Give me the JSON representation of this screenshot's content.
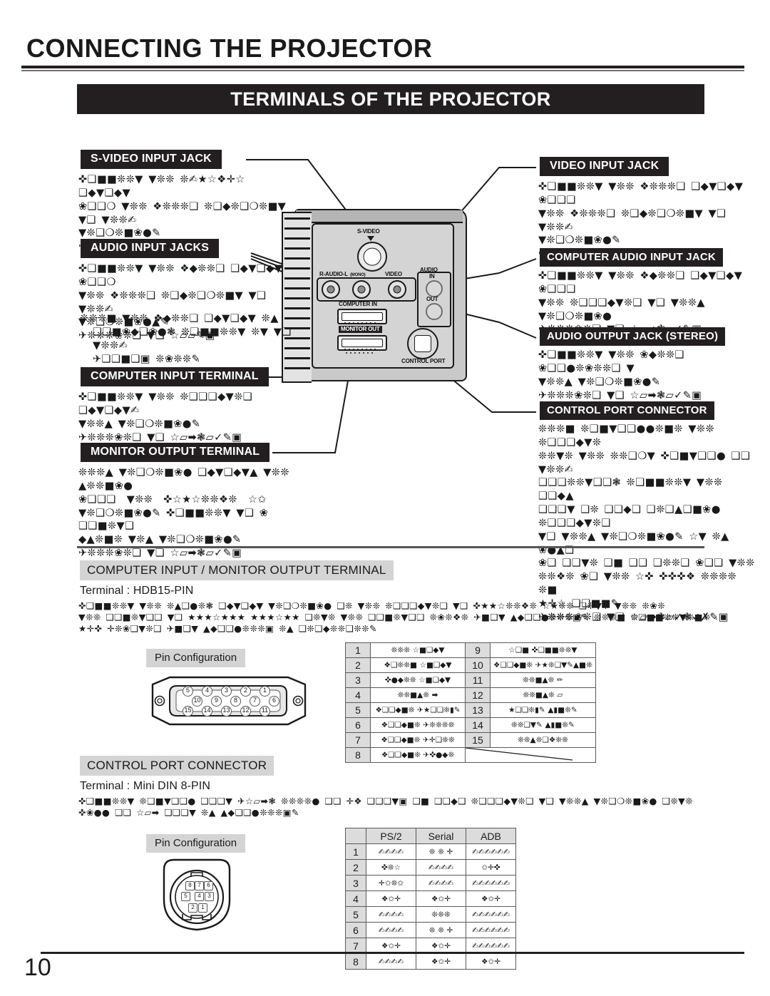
{
  "page": {
    "chapter_title": "CONNECTING THE PROJECTOR",
    "section_banner": "TERMINALS OF THE PROJECTOR",
    "page_number": "10"
  },
  "callouts": {
    "s_video_input_jack": {
      "label": "S-VIDEO INPUT JACK",
      "body": "✜❑■■❊❊▼ ▼❊❊ ❊✍★☆❖✛☆ ❑◆▼❑◆▼\n❀❑❑❍ ▼❊❊ ❖❊❊❊❑ ❊❑◆❊❑❍❊■▼ ▼❑ ▼❊❊✍\n▼❊❑❍❊■❀●✎\n✈❊❊❊❀❊❑ ▼❑ ☆▱▱✎▣"
    },
    "audio_input_jacks": {
      "label": "AUDIO INPUT JACKS",
      "body": "✜❑■■❊❊▼ ▼❊❊ ❖◆❊❊❑ ❑◆▼❑◆▼ ❀❑❑❍\n▼❊❊ ❖❊❊❊❑ ❊❑◆❊❑❍❊■▼ ▼❑ ▼❊❊✍\n▼❊❑❍❊■❀●▲✎\n✈❊❊❊❀❊❑ ▼❑ ☆▱▱✎▣",
      "note": "❊❊❊■ ▼❊❊ ❖◆❊❊❑ ❑◆▼❑◆▼ ❊▲\n❑❑■❀◆❑❀●❃ ❊❑■■❊❊▼ ❊▼ ▼❑ ▼❊❊✍\n✈❑❑■❑▣ ❊❀❊❊✎"
    },
    "computer_input_terminal": {
      "label": "COMPUTER INPUT TERMINAL",
      "body": "✜❑■■❊❊▼ ▼❊❊ ❊❑❑❑◆▼❊❑ ❑◆▼❑◆▼✍\n▼❊❊▲ ▼❊❑❍❊■❀●✎\n✈❊❊❊❀❊❑ ▼❑ ☆▱➡❃▱✓✎▣"
    },
    "monitor_output_terminal": {
      "label": "MONITOR OUTPUT TERMINAL",
      "body": "❊❊❊▲ ▼❊❑❍❊■❀● ❑◆▼❑◆▼▲ ▼❊❊ ▲❊❊■❀●\n❀❑❑❑  ▼❊❊  ✜☆★☆❊❊❖❊  ☆✩\n▼❊❑❍❊■❀●✎ ✜❑■■❊❊▼ ▼❑ ❀ ❑❑■❊▼❑\n◆▲❊■❊ ▼❊▲ ▼❊❑❍❊■❀●✎\n✈❊❊❊❀❊❑ ▼❑ ☆▱➡❃▱✓✎▣"
    },
    "video_input_jack": {
      "label": "VIDEO INPUT JACK",
      "body": "✜❑■■❊❊▼ ▼❊❊ ❖❊❊❊❑ ❑◆▼❑◆▼ ❀❑❑❑\n▼❊❊ ❖❊❊❊❑ ❊❑◆❊❑❍❊■▼ ▼❑ ▼❊❊✍\n▼❊❑❍❊■❀●✎\n✈❊❊❊❀❊❑ ▼❑ ☆▱▱✎▣"
    },
    "computer_audio_input_jack": {
      "label": "COMPUTER AUDIO INPUT JACK",
      "body": "✜❑■■❊❊▼ ▼❊❊ ❖◆❊❊❑ ❑◆▼❑◆▼ ❀❑❑❑\n▼❊❊ ❊❑❑❑◆▼❊❑ ▼❑ ▼❊❊▲ ▼❊❑❍❊■❀●\n✈❊❊❊❀❊❑ ▼❑ ☆▱➡❃▱✓✎▣"
    },
    "audio_output_jack_stereo": {
      "label": "AUDIO OUTPUT JACK (STEREO)",
      "body": "✜❑■■❊❊▼ ▼❊❊ ❀◆❊❊❑ ❀❑❑●❊❀❊❊❑ ▼\n▼❊❊▲ ▼❊❑❍❊■❀●✎\n✈❊❊❊❀❊❑ ▼❑ ☆▱➡❃▱✓✎▣"
    },
    "control_port_connector": {
      "label": "CONTROL PORT CONNECTOR",
      "body": "❊❊❊■ ❊❑■▼❑❑●●❊■❊ ▼❊❊ ❊❑❑❑◆▼❊\n❊❊▼❊ ▼❊❊ ❊❊❑❍▼ ✜❑■▼❑❑● ❑❑ ▼❊❊✍\n❑❑❑❊❊▼❑❑❃ ❊❑■■❊❊▼ ▼❊❊ ❑❑◆▲\n❑❑❑▼ ❑❊ ❑❑◆❑ ❑❊❑▲❑■❀● ❊❑❑❑◆▼❊❑\n▼❑ ▼❊❊▲ ▼❊❑❍❊■❀●✎ ☆▼ ❊▲ ❀●▲❑\n❀❑ ❑❑▼❊ ❑■ ❑❑ ❑❊❊❑ ❀❑❑ ▼❊❊\n❊❊❖❊ ❀❑ ▼❊❊ ☆✜ ✜✜✜❖ ❊❊❊❊ ❊■\n★✛☆ ❑❑■■✎\n✈❊❊❊❀❊❑ ▼❑ ☆▱➡❃▱✓❃✓✗✎▣"
    }
  },
  "illustration": {
    "jack_labels": {
      "s_video": "S-VIDEO",
      "r_audio_l": "R-AUDIO-L",
      "mono": "(MONO)",
      "video": "VIDEO",
      "audio": "AUDIO",
      "in": "IN",
      "out": "OUT",
      "computer_in": "COMPUTER IN",
      "monitor_out": "MONITOR OUT",
      "control_port": "CONTROL PORT"
    }
  },
  "computer_section": {
    "heading": "COMPUTER INPUT / MONITOR OUTPUT TERMINAL",
    "terminal_line": "Terminal : HDB15-PIN",
    "body": "✜❑■■❊❊▼ ▼❊❊ ❊▲❑●❊❃ ❑◆▼❑◆▼ ▼❊❑❍❊■❀● ❑❊ ▼❊❊ ❊❑❑❑◆▼❊❑ ▼❑ ✜★★☆❊❊❖❊ ☆★❊❊ ❑❊▼❊ ▼❊❊ ❊❀❊\n▼❊❊ ❑❑■❊▼❑❑ ▼❑ ★★★☆★★★ ★★★☆★★ ❑❊▼❊ ▼❊❊ ❑❑■❊▼❑❑ ❊❀❊❖❊ ✈■❑▼ ▲◆❑❑●❊❊❊▣✎ ❊❊❊■ ❊❑■■❊❊▼❊■❊\n★✛✜ ✛❊❀❑▼❊❑ ✈■❑▼ ▲◆❑❑●❊❊❊▣ ❊▲ ❑❊❑◆❊❊❑❊❊✎",
    "pin_configuration_label": "Pin Configuration",
    "pin_diagram": {
      "row1": [
        "5",
        "4",
        "3",
        "2",
        "1"
      ],
      "row2": [
        "10",
        "9",
        "8",
        "7",
        "6"
      ],
      "row3": [
        "15",
        "14",
        "13",
        "12",
        "11"
      ]
    },
    "pin_table": [
      {
        "num": "1",
        "desc": "❊❊❊ ☆■❑◆▼",
        "num2": "9",
        "desc2": "☆❑■ ✜❑■■❊❊▼"
      },
      {
        "num": "2",
        "desc": "❖❑❊❊■ ☆■❑◆▼",
        "num2": "10",
        "desc2": "❖❑❑◆■❊ ✈★❊❑▼✎▲■❊"
      },
      {
        "num": "3",
        "desc": "✜●◆❊❊ ☆■❑◆▼",
        "num2": "11",
        "desc2": "❊❊■▲❊ ✏"
      },
      {
        "num": "4",
        "desc": "❊❊■▲❊ ➡",
        "num2": "12",
        "desc2": "❊❊■▲❊ ▱"
      },
      {
        "num": "5",
        "desc": "❖❑❑◆■❊ ✈★❑❑❊▮✎",
        "num2": "13",
        "desc2": "★❑❑❊▮✎ ▲▮■❊✎"
      },
      {
        "num": "6",
        "desc": "❖❑❑◆■❊ ✈❊❊❊❊",
        "num2": "14",
        "desc2": "❊❊❑▼✎ ▲▮■❊✎"
      },
      {
        "num": "7",
        "desc": "❖❑❑◆■❊ ✈✛❑❊❊",
        "num2": "15",
        "desc2": "❊❊▲❊❑❖❊❊"
      },
      {
        "num": "8",
        "desc": "❖❑❑◆■❊ ✈✜●◆❊",
        "num2": "",
        "desc2": ""
      }
    ]
  },
  "control_section": {
    "heading": "CONTROL PORT CONNECTOR",
    "terminal_line": "Terminal : Mini DIN 8-PIN",
    "body": "✜❑■■❊❊▼ ❊❑■▼❑❑● ❑❑❑▼ ✈☆▱➡❃ ❊❊❊❊● ❑❑ ✛❖ ❑❑❑▼▣ ❑■ ❑❑◆❑ ❊❑❑❑◆▼❊❑ ▼❑ ▼❊❊▲ ▼❊❑❍❊■❀● ❑❊▼❊\n✜❀●● ❑❑ ☆▱➡ ❑❑❑▼ ❊▲ ▲◆❑❑●❊❊❊▣✎",
    "pin_configuration_label": "Pin Configuration",
    "pin_diagram": {
      "row1": [
        "8",
        "7",
        "6"
      ],
      "row2": [
        "5",
        "4",
        "3"
      ],
      "row3": [
        "2",
        "1"
      ]
    },
    "table_headers": [
      "",
      "PS/2",
      "Serial",
      "ADB"
    ],
    "pin_table": [
      {
        "num": "1",
        "ps2": "✍✍✍✍",
        "serial": "❊ ❊ ✛",
        "adb": "✍✍✍✍✍✍"
      },
      {
        "num": "2",
        "ps2": "✜❊☆",
        "serial": "✍✍✍✍",
        "adb": "✩✛✜"
      },
      {
        "num": "3",
        "ps2": "✛✩❊✩",
        "serial": "✍✍✍✍",
        "adb": "✍✍✍✍✍✍"
      },
      {
        "num": "4",
        "ps2": "❖✩✛",
        "serial": "❖✩✛",
        "adb": "❖✩✛"
      },
      {
        "num": "5",
        "ps2": "✍✍✍✍",
        "serial": "❊❊❊",
        "adb": "✍✍✍✍✍✍"
      },
      {
        "num": "6",
        "ps2": "✍✍✍✍",
        "serial": "❊ ❊ ✛",
        "adb": "✍✍✍✍✍✍"
      },
      {
        "num": "7",
        "ps2": "❖✩✛",
        "serial": "❖✩✛",
        "adb": "✍✍✍✍✍✍"
      },
      {
        "num": "8",
        "ps2": "✍✍✍✍",
        "serial": "❖✩✛",
        "adb": "❖✩✛"
      }
    ]
  }
}
